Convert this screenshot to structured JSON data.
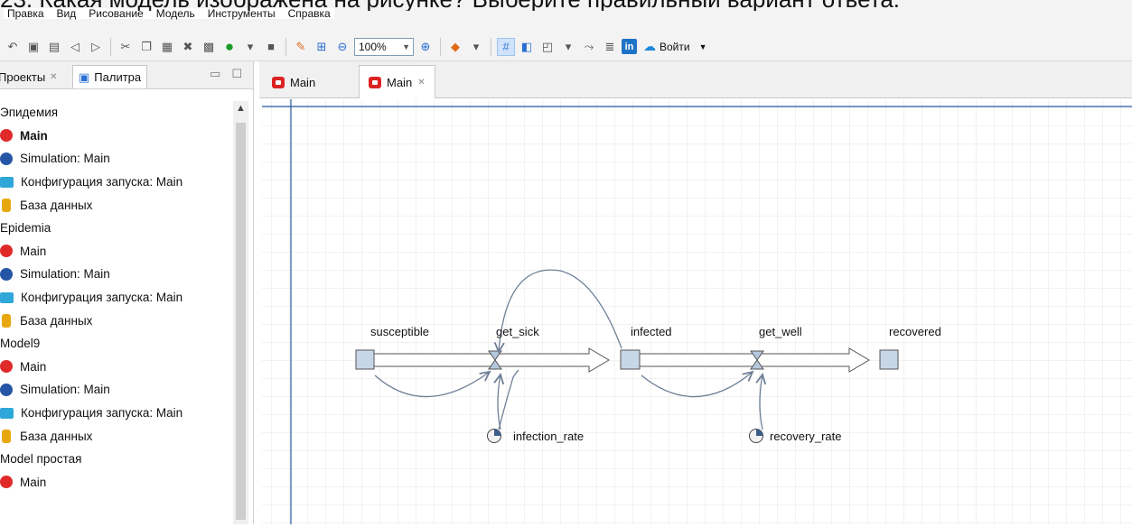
{
  "question_text": "23. Какая модель изображена на рисунке? Выберите правильный вариант ответа.",
  "menu": [
    "Правка",
    "Вид",
    "Рисование",
    "Модель",
    "Инструменты",
    "Справка"
  ],
  "toolbar": {
    "zoom_value": "100%",
    "login_label": "Войти"
  },
  "left_panel": {
    "tabs": [
      {
        "label": "Проекты"
      },
      {
        "label": "Палитра"
      }
    ],
    "tree": [
      {
        "label": "Эпидемия",
        "icon": "folder",
        "level": 0
      },
      {
        "label": "Main",
        "icon": "main-agent",
        "level": 1,
        "bold": true
      },
      {
        "label": "Simulation: Main",
        "icon": "simulation",
        "level": 1
      },
      {
        "label": "Конфигурация запуска: Main",
        "icon": "run-config",
        "level": 1
      },
      {
        "label": "База данных",
        "icon": "database",
        "level": 1
      },
      {
        "label": "Epidemia",
        "icon": "folder",
        "level": 0
      },
      {
        "label": "Main",
        "icon": "main-agent",
        "level": 1
      },
      {
        "label": "Simulation: Main",
        "icon": "simulation",
        "level": 1
      },
      {
        "label": "Конфигурация запуска: Main",
        "icon": "run-config",
        "level": 1
      },
      {
        "label": "База данных",
        "icon": "database",
        "level": 1
      },
      {
        "label": "Model9",
        "icon": "folder",
        "level": 0
      },
      {
        "label": "Main",
        "icon": "main-agent",
        "level": 1
      },
      {
        "label": "Simulation: Main",
        "icon": "simulation",
        "level": 1
      },
      {
        "label": "Конфигурация запуска: Main",
        "icon": "run-config",
        "level": 1
      },
      {
        "label": "База данных",
        "icon": "database",
        "level": 1
      },
      {
        "label": "Model простая",
        "icon": "folder",
        "level": 0
      },
      {
        "label": "Main",
        "icon": "main-agent",
        "level": 1
      }
    ]
  },
  "editor_tabs": [
    {
      "label": "Main",
      "active": false
    },
    {
      "label": "Main",
      "active": true
    }
  ],
  "diagram": {
    "stocks": [
      "susceptible",
      "infected",
      "recovered"
    ],
    "flows": [
      "get_sick",
      "get_well"
    ],
    "parameters": [
      "infection_rate",
      "recovery_rate"
    ]
  },
  "colors": {
    "stock_fill": "#c7d7e8",
    "grid": "#e6e6e6",
    "guide": "#2a5aa0"
  }
}
